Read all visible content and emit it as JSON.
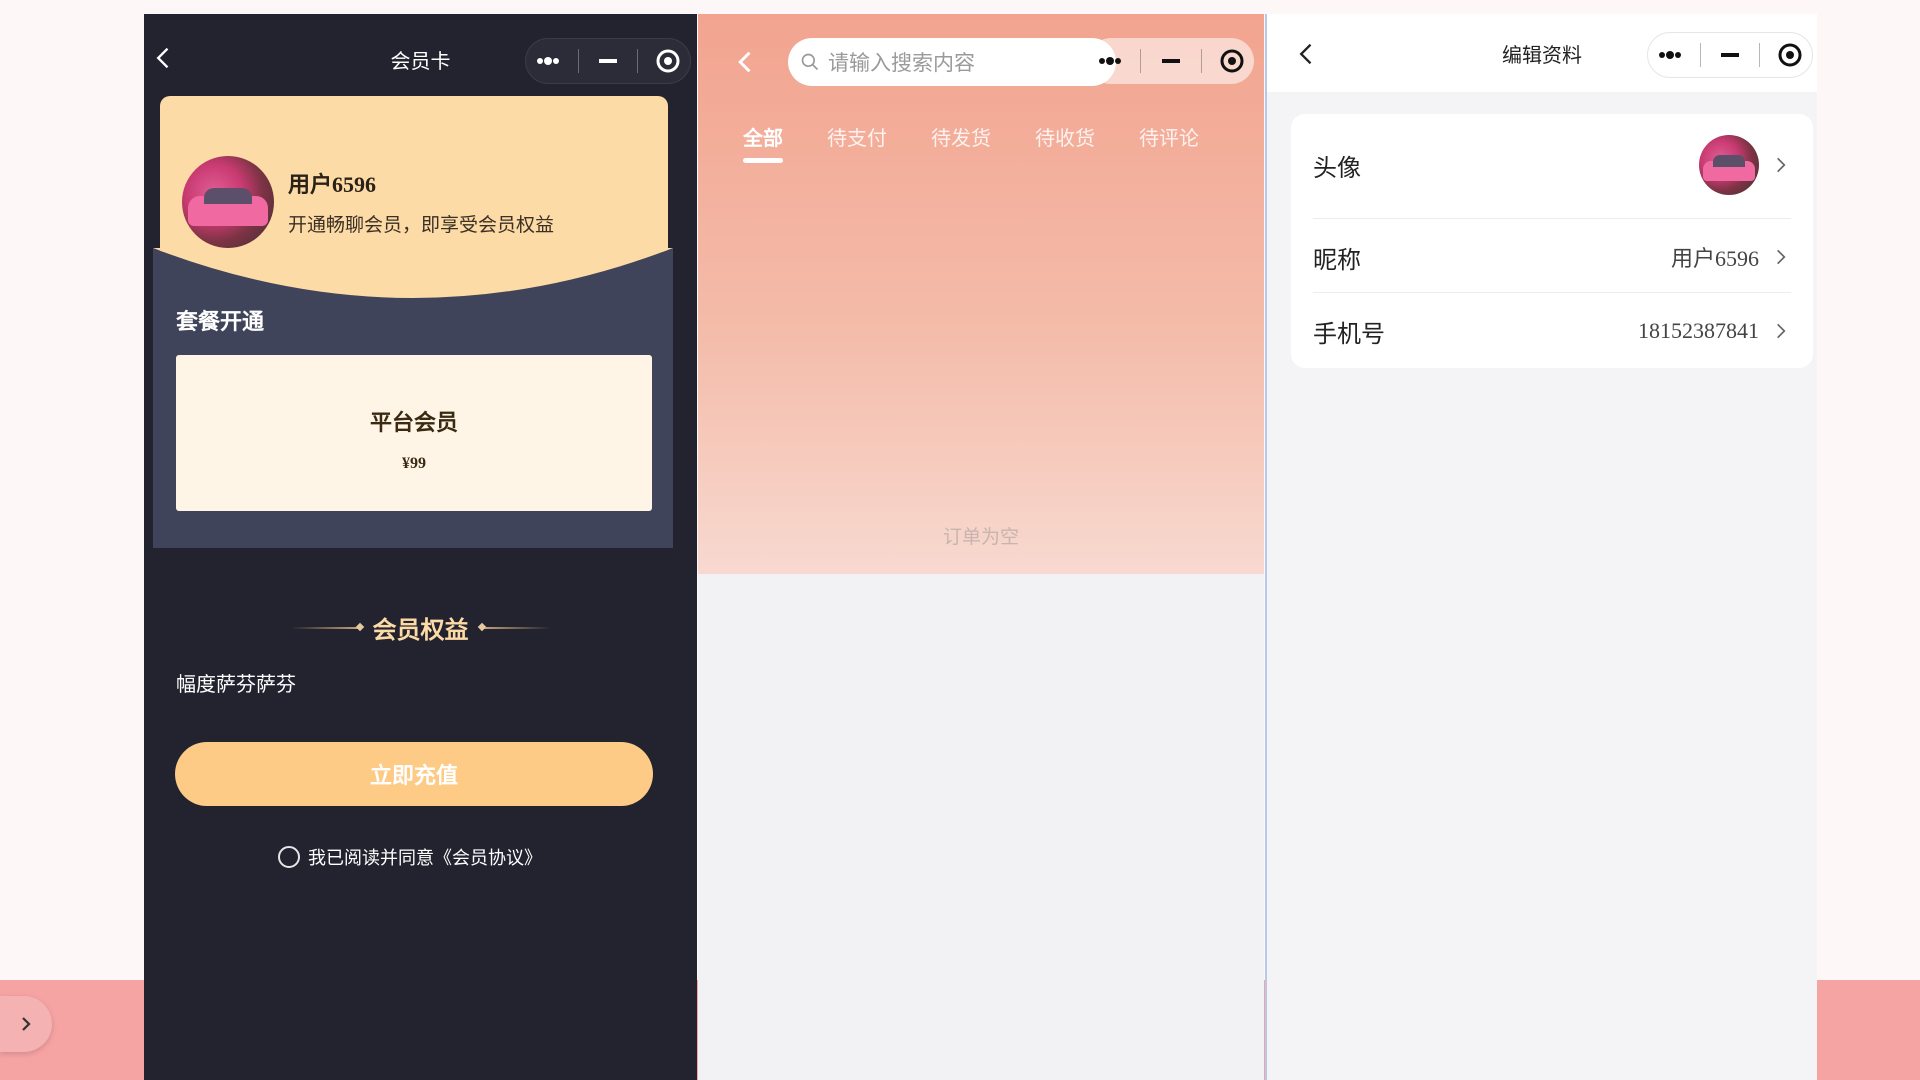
{
  "member_panel": {
    "title": "会员卡",
    "user_name": "用户6596",
    "user_subtitle": "开通畅聊会员，即享受会员权益",
    "section_title": "套餐开通",
    "plan": {
      "name": "平台会员",
      "price": "¥99"
    },
    "benefits_title": "会员权益",
    "benefits_text": "幅度萨芬萨芬",
    "recharge_label": "立即充值",
    "agreement_text": "我已阅读并同意《会员协议》"
  },
  "orders_panel": {
    "search_placeholder": "请输入搜索内容",
    "tabs": [
      {
        "label": "全部",
        "active": true
      },
      {
        "label": "待支付"
      },
      {
        "label": "待发货"
      },
      {
        "label": "待收货"
      },
      {
        "label": "待评论"
      }
    ],
    "empty_text": "订单为空"
  },
  "profile_panel": {
    "title": "编辑资料",
    "rows": [
      {
        "label": "头像"
      },
      {
        "label": "昵称",
        "value": "用户6596"
      },
      {
        "label": "手机号",
        "value": "18152387841"
      }
    ]
  },
  "icons": {
    "back": "chevron-left-icon",
    "menu": "more-dots-icon",
    "minimize": "minimize-icon",
    "close": "target-close-icon",
    "search": "search-icon",
    "row_arrow": "chevron-right-icon",
    "sidebar_toggle": "chevron-right-icon"
  },
  "colors": {
    "member_bg": "#23232f",
    "card_gold": "#fddba6",
    "button_gold": "#fdcb86",
    "orders_gradient_top": "#f2a48f",
    "background_pink": "#f6a3a3"
  }
}
